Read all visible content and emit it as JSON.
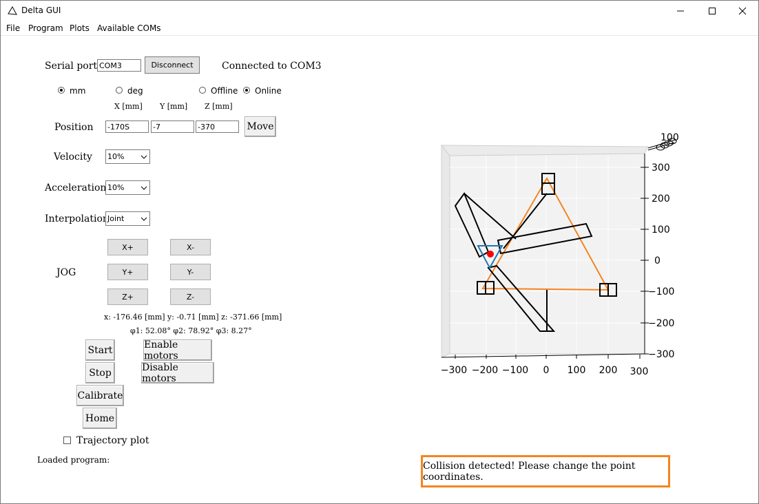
{
  "window": {
    "title": "Delta GUI"
  },
  "menu": [
    "File",
    "Program",
    "Plots",
    "Available COMs"
  ],
  "serial": {
    "label": "Serial port",
    "port_value": "COM3",
    "disconnect_label": "Disconnect",
    "status": "Connected to COM3"
  },
  "units": {
    "mm_label": "mm",
    "deg_label": "deg",
    "offline_label": "Offline",
    "online_label": "Online",
    "selected_unit": "mm",
    "selected_mode": "Online"
  },
  "coords_headers": [
    "X [mm]",
    "Y [mm]",
    "Z [mm]"
  ],
  "position": {
    "label": "Position",
    "x": "-170S",
    "y": "-7",
    "z": "-370",
    "move_label": "Move"
  },
  "velocity": {
    "label": "Velocity",
    "value": "10%"
  },
  "acceleration": {
    "label": "Acceleration",
    "value": "10%"
  },
  "interpolation": {
    "label": "Interpolation",
    "value": "Joint"
  },
  "jog": {
    "label": "JOG",
    "buttons": [
      "X+",
      "X-",
      "Y+",
      "Y-",
      "Z+",
      "Z-"
    ]
  },
  "readout": {
    "xyz": "x: -176.46 [mm] y: -0.71 [mm] z: -371.66 [mm]",
    "angles": "φ1: 52.08° φ2: 78.92° φ3: 8.27°"
  },
  "controls": {
    "start": "Start",
    "stop": "Stop",
    "calibrate": "Calibrate",
    "home": "Home",
    "enable": "Enable motors",
    "disable": "Disable motors"
  },
  "trajectory_plot_label": "Trajectory plot",
  "loaded_program_label": "Loaded program:",
  "message": "Collision detected! Please change the point coordinates.",
  "plot": {
    "x_ticks": [
      "−300",
      "−200",
      "−100",
      "0",
      "100",
      "200",
      "300"
    ],
    "y_ticks": [
      "300",
      "200",
      "100",
      "0",
      "−100",
      "−200",
      "−300"
    ],
    "z_tick": "100",
    "colors": {
      "base": "#f5841f",
      "platform": "#1f77b4",
      "end_effector": "#ff0000"
    }
  }
}
